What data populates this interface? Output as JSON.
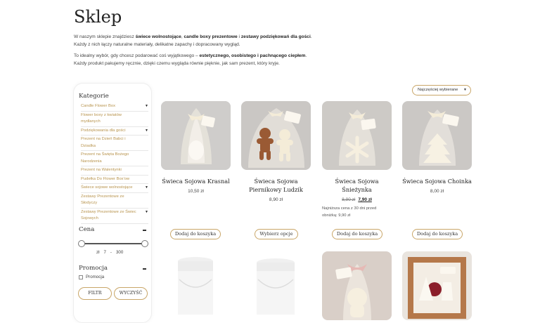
{
  "page": {
    "title": "Sklep",
    "intro1_a": "W naszym sklepie znajdziesz ",
    "intro1_b1": "świece wolnostojące",
    "intro1_c": ", ",
    "intro1_b2": "candle boxy prezentowe",
    "intro1_d": " i ",
    "intro1_b3": "zestawy podziękowań dla gości",
    "intro1_e": ".",
    "intro2": "Każdy z nich łączy naturalne materiały, delikatne zapachy i dopracowany wygląd.",
    "intro3_a": "To idealny wybór, gdy chcesz podarować coś wyjątkowego – ",
    "intro3_b": "estetycznego, osobistego i pachnącego ciepłem",
    "intro3_c": ".",
    "intro4": "Każdy produkt pakujemy ręcznie, dzięki czemu wygląda równie pięknie, jak sam prezent, który kryje."
  },
  "sidebar": {
    "categories_title": "Kategorie",
    "categories": [
      {
        "label": "Candle Flower Box",
        "expand": "▼"
      },
      {
        "label": "Flower boxy z kwiatów mydlanych",
        "expand": ""
      },
      {
        "label": "Podziękowania dla gości",
        "expand": "▼"
      },
      {
        "label": "Prezent na Dzień Babci i Dziadka",
        "expand": ""
      },
      {
        "label": "Prezent na Święta Bożego Narodzenia",
        "expand": ""
      },
      {
        "label": "Prezent na Walentynki",
        "expand": ""
      },
      {
        "label": "Pudełka Do Flower Box'ow",
        "expand": ""
      },
      {
        "label": "Świece sojowe wolnostojące",
        "expand": "▼"
      },
      {
        "label": "Zestawy Prezentowe ze Słodyczy",
        "expand": ""
      },
      {
        "label": "Zestawy Prezentowe ze Świec Sojowych",
        "expand": "▼"
      }
    ],
    "price_title": "Cena",
    "currency": "zł",
    "price_min": "7",
    "price_sep": "-",
    "price_max": "300",
    "promo_title": "Promocja",
    "promo_option": "Promocja",
    "filter_button": "FILTR",
    "clear_button": "WYCZYŚĆ"
  },
  "sort": {
    "selected": "Najczęściej wybierane",
    "icon": "chevron-down-icon"
  },
  "products": [
    {
      "name": "Świeca Sojowa Krasnal",
      "price": "10,50 zł",
      "button": "Dodaj do koszyka"
    },
    {
      "name": "Świeca Sojowa Piernikowy Ludzik",
      "price": "8,90 zł",
      "button": "Wybierz opcje"
    },
    {
      "name": "Świeca Sojowa Śnieżynka",
      "old_price": "8,90 zł",
      "new_price": "7,90 zł",
      "lowest": "Najniższa cena z 30 dni przed obniżką: 9,90 zł",
      "button": "Dodaj do koszyka"
    },
    {
      "name": "Świeca Sojowa Choinka",
      "price": "8,00 zł",
      "button": "Dodaj do koszyka"
    }
  ],
  "colors": {
    "accent": "#b8944e",
    "border": "#c9a668"
  }
}
